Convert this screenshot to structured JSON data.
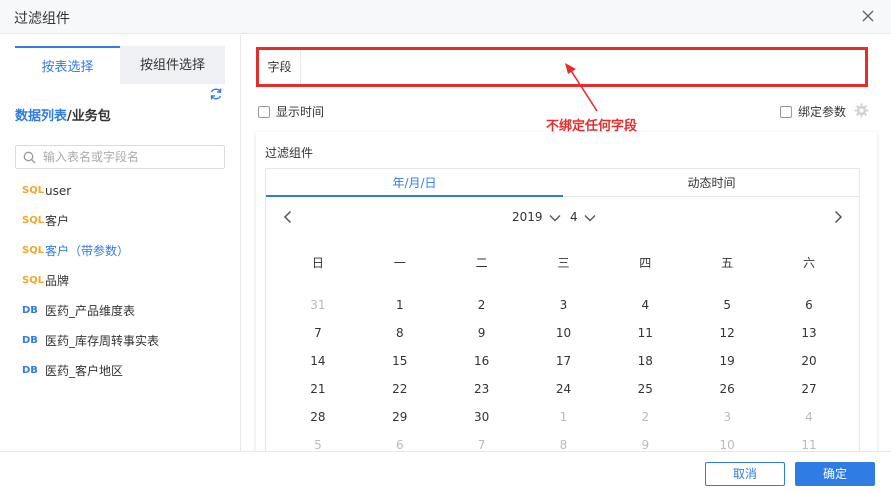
{
  "dialog": {
    "title": "过滤组件"
  },
  "left": {
    "tabs": [
      {
        "label": "按表选择"
      },
      {
        "label": "按组件选择"
      }
    ],
    "package": {
      "part1": "数据列表",
      "part2": "/业务包"
    },
    "search": {
      "placeholder": "输入表名或字段名",
      "value": ""
    },
    "tables": [
      {
        "icon": "SQL",
        "label": "user"
      },
      {
        "icon": "SQL",
        "label": "客户"
      },
      {
        "icon": "SQL",
        "label": "客户（带参数）"
      },
      {
        "icon": "SQL",
        "label": "品牌"
      },
      {
        "icon": "DB",
        "label": "医药_产品维度表"
      },
      {
        "icon": "DB",
        "label": "医药_库存周转事实表"
      },
      {
        "icon": "DB",
        "label": "医药_客户地区"
      }
    ]
  },
  "right": {
    "field": {
      "label": "字段",
      "value": ""
    },
    "annotation": "不绑定任何字段",
    "show_time": "显示时间",
    "bind_param": "绑定参数",
    "panel_title": "过滤组件",
    "cal_tabs": [
      {
        "label": "年/月/日"
      },
      {
        "label": "动态时间"
      }
    ],
    "year": "2019",
    "month": "4",
    "weekdays": [
      "日",
      "一",
      "二",
      "三",
      "四",
      "五",
      "六"
    ],
    "weeks": [
      [
        "31",
        "1",
        "2",
        "3",
        "4",
        "5",
        "6"
      ],
      [
        "7",
        "8",
        "9",
        "10",
        "11",
        "12",
        "13"
      ],
      [
        "14",
        "15",
        "16",
        "17",
        "18",
        "19",
        "20"
      ],
      [
        "21",
        "22",
        "23",
        "24",
        "25",
        "26",
        "27"
      ],
      [
        "28",
        "29",
        "30",
        "1",
        "2",
        "3",
        "4"
      ],
      [
        "5",
        "6",
        "7",
        "8",
        "9",
        "10",
        "11"
      ]
    ],
    "muted": [
      [
        true,
        false,
        false,
        false,
        false,
        false,
        false
      ],
      [
        false,
        false,
        false,
        false,
        false,
        false,
        false
      ],
      [
        false,
        false,
        false,
        false,
        false,
        false,
        false
      ],
      [
        false,
        false,
        false,
        false,
        false,
        false,
        false
      ],
      [
        false,
        false,
        false,
        true,
        true,
        true,
        true
      ],
      [
        true,
        true,
        true,
        true,
        true,
        true,
        true
      ]
    ]
  },
  "footer": {
    "cancel": "取消",
    "ok": "确定"
  },
  "colors": {
    "accent": "#2e7ce4",
    "annotation": "#e52d2d",
    "sql_icon": "#f5a623",
    "db_icon": "#2e7ce4"
  }
}
